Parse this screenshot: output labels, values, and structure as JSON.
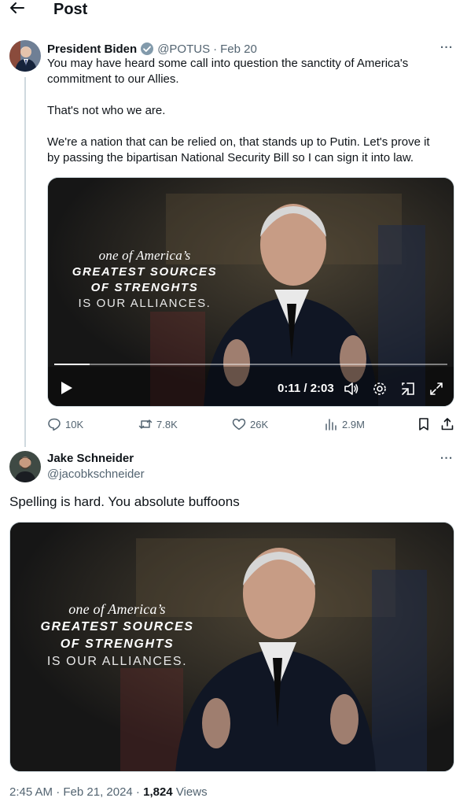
{
  "header": {
    "title": "Post"
  },
  "tweet1": {
    "name": "President Biden",
    "handle": "@POTUS",
    "date": "Feb 20",
    "para1": "You may have heard some call into question the sanctity of America's\ncommitment to our Allies.",
    "para2": "That's not who we are.",
    "para3": "We're a nation that can be relied on, that stands up to Putin. Let's prove it\nby passing the bipartisan National Security Bill so I can sign it into law.",
    "video": {
      "caption_line1": "one of America’s",
      "caption_line2": "GREATEST SOURCES",
      "caption_line3": "OF STRENGHTS",
      "caption_line4": "IS OUR ALLIANCES.",
      "time": "0:11 / 2:03",
      "progress": 0.09
    },
    "stats": {
      "replies": "10K",
      "reposts": "7.8K",
      "likes": "26K",
      "views": "2.9M"
    }
  },
  "reply": {
    "name": "Jake Schneider",
    "handle": "@jacobkschneider",
    "text": "Spelling is hard. You absolute buffoons",
    "image": {
      "caption_line1": "one of America’s",
      "caption_line2": "GREATEST SOURCES",
      "caption_line3": "OF STRENGHTS",
      "caption_line4": "IS OUR ALLIANCES."
    },
    "time": "2:45 AM · Feb 21, 2024 ·",
    "views_count": "1,824",
    "views_label": "Views"
  },
  "colors": {
    "text": "#0f1419",
    "muted": "#536471",
    "verified": "#829aab",
    "border": "#cfd9de"
  },
  "icons": [
    "back-arrow-icon",
    "verified-badge-icon",
    "more-icon",
    "play-icon",
    "volume-icon",
    "settings-icon",
    "pip-icon",
    "fullscreen-icon",
    "reply-icon",
    "repost-icon",
    "like-icon",
    "views-icon",
    "bookmark-icon",
    "share-icon"
  ]
}
